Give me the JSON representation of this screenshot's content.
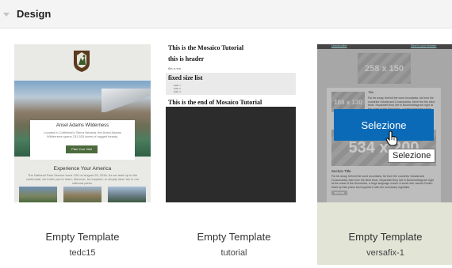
{
  "section": {
    "title": "Design"
  },
  "templates": [
    {
      "title": "Empty Template",
      "id": "tedc15",
      "preview": {
        "hero_title": "Ansel Adams Wilderness",
        "hero_text": "Located in California's Sierra Nevada, the Ansel Adams Wilderness spans 231,533 acres of rugged beauty.",
        "button": "Plan Your Visit",
        "section_title": "Experience Your America",
        "section_text": "The National Park Service turns 100 on August 25, 2016. As we lead up to the centennial, we invite you to learn, discover, be inspired, or simply have fun in our national parks."
      }
    },
    {
      "title": "Empty Template",
      "id": "tutorial",
      "preview": {
        "line1": "This is the Mosaico Tutorial",
        "line2": "this is header",
        "line3": "this is text",
        "line4": "fixed size list",
        "items": [
          "item 1",
          "item 2",
          "item 3"
        ],
        "line5": "This is the end of Mosaico Tutorial"
      }
    },
    {
      "title": "Empty Template",
      "id": "versafix-1",
      "preview": {
        "top_left": "Unsubscribe",
        "top_right": "View in your browser",
        "ph_top": "258 x 150",
        "ph_left": "166 x 130",
        "block_title": "Title",
        "block_text": "Far far away, behind the word mountains, far from the countries Vokalia and Consonantia, there live the blind texts. Separated they live in Bookmarksgrove right at the coast of the Semantics, a large language ocean.",
        "ph_big": "534 x 200",
        "section_title": "Section Title",
        "section_text": "Far far away, behind the word mountains, far from the countries Vokalia and Consonantia, there live the blind texts. Separated they live in Bookmarksgrove right at the coast of the Semantics, a large language ocean. A small river named Duden flows by their place and supplies it with the necessary regelialia.",
        "button": "BUTTON"
      },
      "hover_button": "Selezione",
      "tooltip": "Selezione"
    }
  ],
  "colors": {
    "accent": "#0b6ab8",
    "selected_card_bg": "#e2e4d6"
  }
}
